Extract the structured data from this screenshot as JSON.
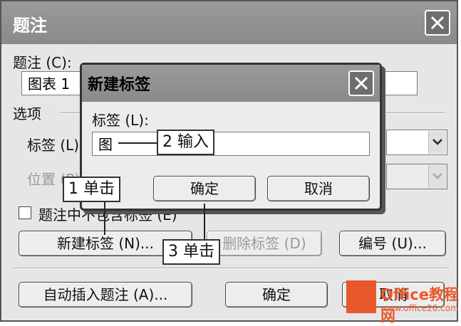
{
  "outer": {
    "title": "题注",
    "caption_label": "题注 (C):",
    "caption_value": "图表 1",
    "options_label": "选项",
    "label_label": "标签 (L)",
    "position_label": "位置 (P)",
    "exclude_label": "题注中不包含标签 (E)",
    "new_label_button": "新建标签 (N)...",
    "delete_label_button": "删除标签 (D)",
    "numbering_button": "编号 (U)...",
    "autocaption_button": "自动插入题注 (A)...",
    "ok_button": "确定",
    "cancel_button": "取消"
  },
  "inner": {
    "title": "新建标签",
    "label_label": "标签 (L):",
    "label_value": "图",
    "ok_button": "确定",
    "cancel_button": "取消"
  },
  "callouts": {
    "step1": "1 单击",
    "step2": "2 输入",
    "step3": "3 单击"
  },
  "watermark": {
    "brand": "Office教程网",
    "url": "www.office26.com"
  }
}
